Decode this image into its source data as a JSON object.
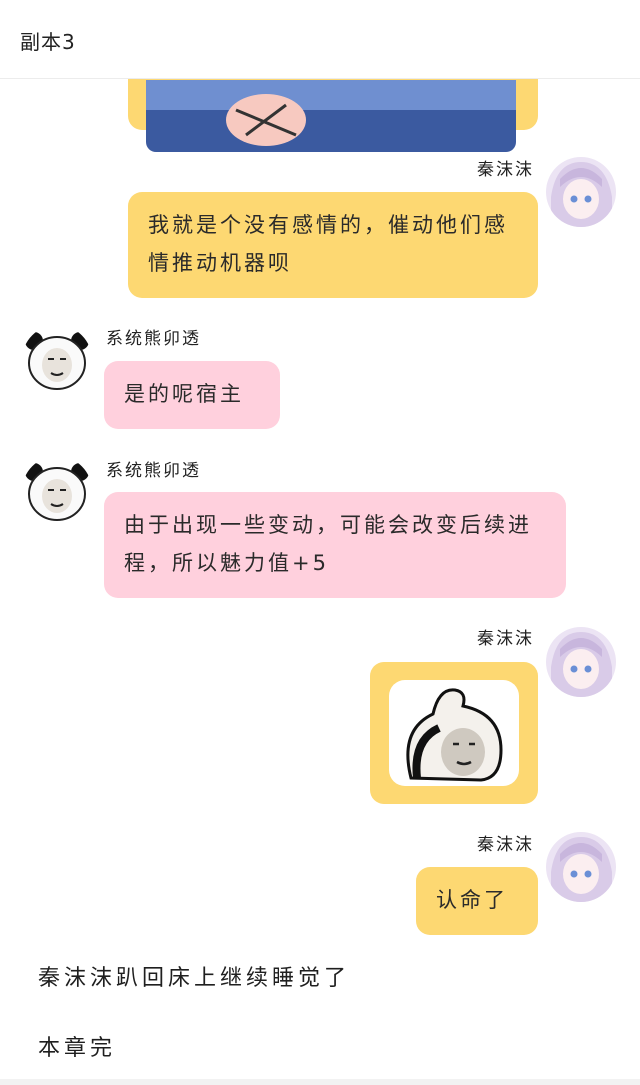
{
  "header": {
    "title": "副本3"
  },
  "messages": [
    {
      "sender": "秦沫沫",
      "text": "我就是个没有感情的，催动他们感情推动机器呗"
    },
    {
      "sender": "系统熊卯透",
      "text": "是的呢宿主"
    },
    {
      "sender": "系统熊卯透",
      "text": "由于出现一些变动，可能会改变后续进程，所以魅力值+5"
    },
    {
      "sender": "秦沫沫",
      "sticker": "meme-face-sticker"
    },
    {
      "sender": "秦沫沫",
      "text": "认命了"
    }
  ],
  "narration": [
    "秦沫沫趴回床上继续睡觉了",
    "本章完"
  ],
  "colors": {
    "self_bubble": "#fdd872",
    "system_bubble": "#ffd0dd"
  }
}
